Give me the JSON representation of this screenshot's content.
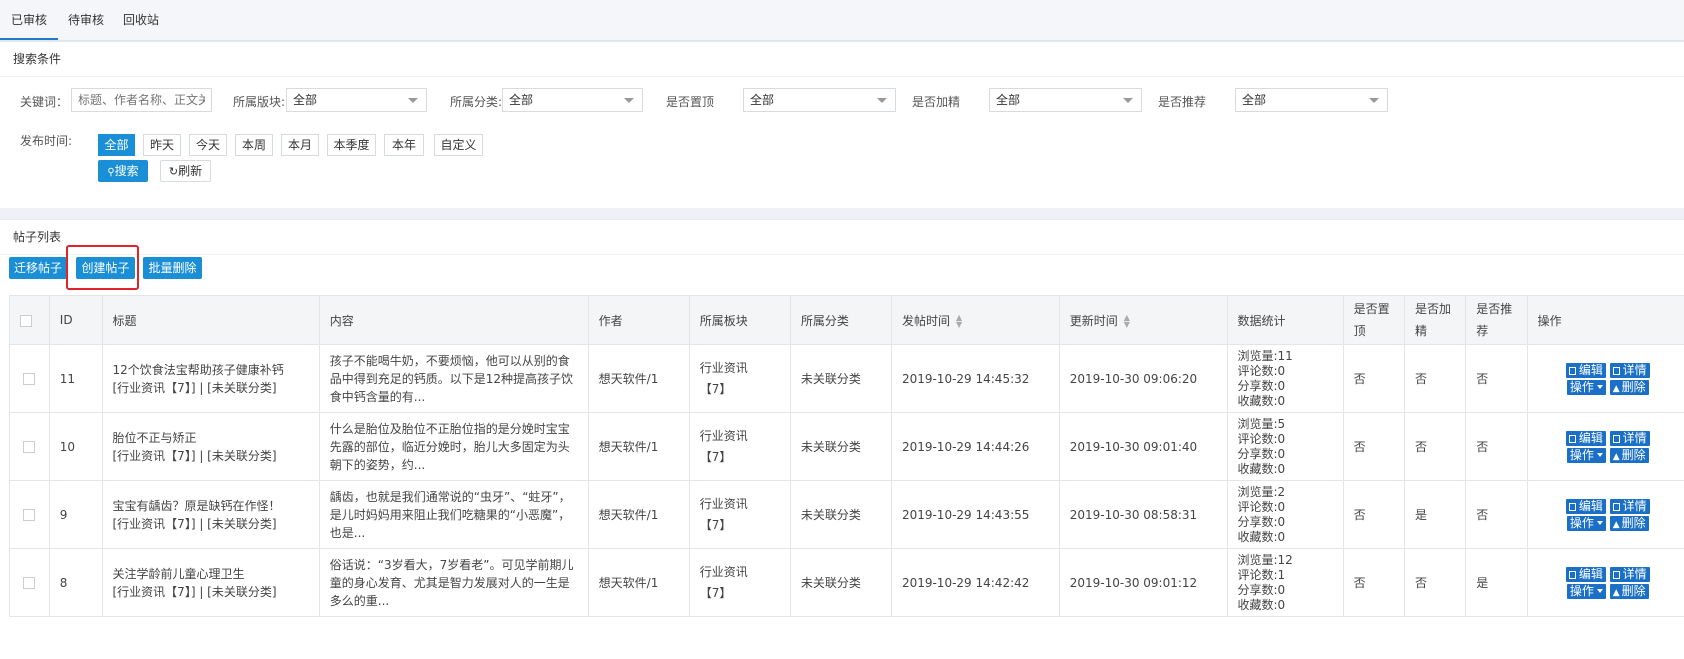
{
  "tabs": [
    "已审核",
    "待审核",
    "回收站"
  ],
  "search": {
    "title": "搜索条件",
    "keyword_label": "关键词：",
    "keyword_placeholder": "标题、作者名称、正文关键",
    "block_label": "所属版块:",
    "block_value": "全部",
    "category_label": "所属分类:",
    "category_value": "全部",
    "top_label": "是否置顶",
    "top_value": "全部",
    "essence_label": "是否加精",
    "essence_value": "全部",
    "recommend_label": "是否推荐",
    "recommend_value": "全部",
    "time_label": "发布时间:",
    "time_options": [
      "全部",
      "昨天",
      "今天",
      "本周",
      "本月",
      "本季度",
      "本年",
      "自定义"
    ],
    "search_button": "搜索",
    "refresh_button": "刷新"
  },
  "list": {
    "title": "帖子列表",
    "move_button": "迁移帖子",
    "create_button": "创建帖子",
    "batch_delete_button": "批量删除"
  },
  "table": {
    "headers": [
      "ID",
      "标题",
      "内容",
      "作者",
      "所属板块",
      "所属分类",
      "发帖时间",
      "更新时间",
      "数据统计",
      "是否置顶",
      "是否加精",
      "是否推荐",
      "操作"
    ],
    "rows": [
      {
        "id": "11",
        "title": "12个饮食法宝帮助孩子健康补钙",
        "title_sub": "[行业资讯【7】] | [未关联分类]",
        "content": "孩子不能喝牛奶，不要烦恼，他可以从别的食品中得到充足的钙质。以下是12种提高孩子饮食中钙含量的有...",
        "author": "想天软件/1",
        "block": "行业资讯",
        "block_sub": "【7】",
        "category": "未关联分类",
        "post_time": "2019-10-29 14:45:32",
        "update_time": "2019-10-30 09:06:20",
        "views": "浏览量:11",
        "comments": "评论数:0",
        "shares": "分享数:0",
        "favorites": "收藏数:0",
        "is_top": "否",
        "is_essence": "否",
        "is_recommend": "否"
      },
      {
        "id": "10",
        "title": "胎位不正与矫正",
        "title_sub": "[行业资讯【7】] | [未关联分类]",
        "content": "什么是胎位及胎位不正胎位指的是分娩时宝宝先露的部位，临近分娩时，胎儿大多固定为头朝下的姿势，约...",
        "author": "想天软件/1",
        "block": "行业资讯",
        "block_sub": "【7】",
        "category": "未关联分类",
        "post_time": "2019-10-29 14:44:26",
        "update_time": "2019-10-30 09:01:40",
        "views": "浏览量:5",
        "comments": "评论数:0",
        "shares": "分享数:0",
        "favorites": "收藏数:0",
        "is_top": "否",
        "is_essence": "否",
        "is_recommend": "否"
      },
      {
        "id": "9",
        "title": "宝宝有龋齿？原是缺钙在作怪！",
        "title_sub": "[行业资讯【7】] | [未关联分类]",
        "content": "龋齿，也就是我们通常说的“虫牙”、“蛀牙”，是儿时妈妈用来阻止我们吃糖果的“小恶魔”，也是...",
        "author": "想天软件/1",
        "block": "行业资讯",
        "block_sub": "【7】",
        "category": "未关联分类",
        "post_time": "2019-10-29 14:43:55",
        "update_time": "2019-10-30 08:58:31",
        "views": "浏览量:2",
        "comments": "评论数:0",
        "shares": "分享数:0",
        "favorites": "收藏数:0",
        "is_top": "否",
        "is_essence": "是",
        "is_recommend": "否"
      },
      {
        "id": "8",
        "title": "关注学龄前儿童心理卫生",
        "title_sub": "[行业资讯【7】] | [未关联分类]",
        "content": "俗话说：“3岁看大，7岁看老”。可见学前期儿童的身心发育、尤其是智力发展对人的一生是多么的重...",
        "author": "想天软件/1",
        "block": "行业资讯",
        "block_sub": "【7】",
        "category": "未关联分类",
        "post_time": "2019-10-29 14:42:42",
        "update_time": "2019-10-30 09:01:12",
        "views": "浏览量:12",
        "comments": "评论数:1",
        "shares": "分享数:0",
        "favorites": "收藏数:0",
        "is_top": "否",
        "is_essence": "否",
        "is_recommend": "是"
      }
    ],
    "row_actions": {
      "edit": "编辑",
      "detail": "详情",
      "operate": "操作",
      "delete": "删除"
    }
  },
  "colors": {
    "primary": "#1a8fd6",
    "action": "#1a6fc7",
    "highlight": "#e0242a",
    "header_bg": "#f3f5f7"
  }
}
